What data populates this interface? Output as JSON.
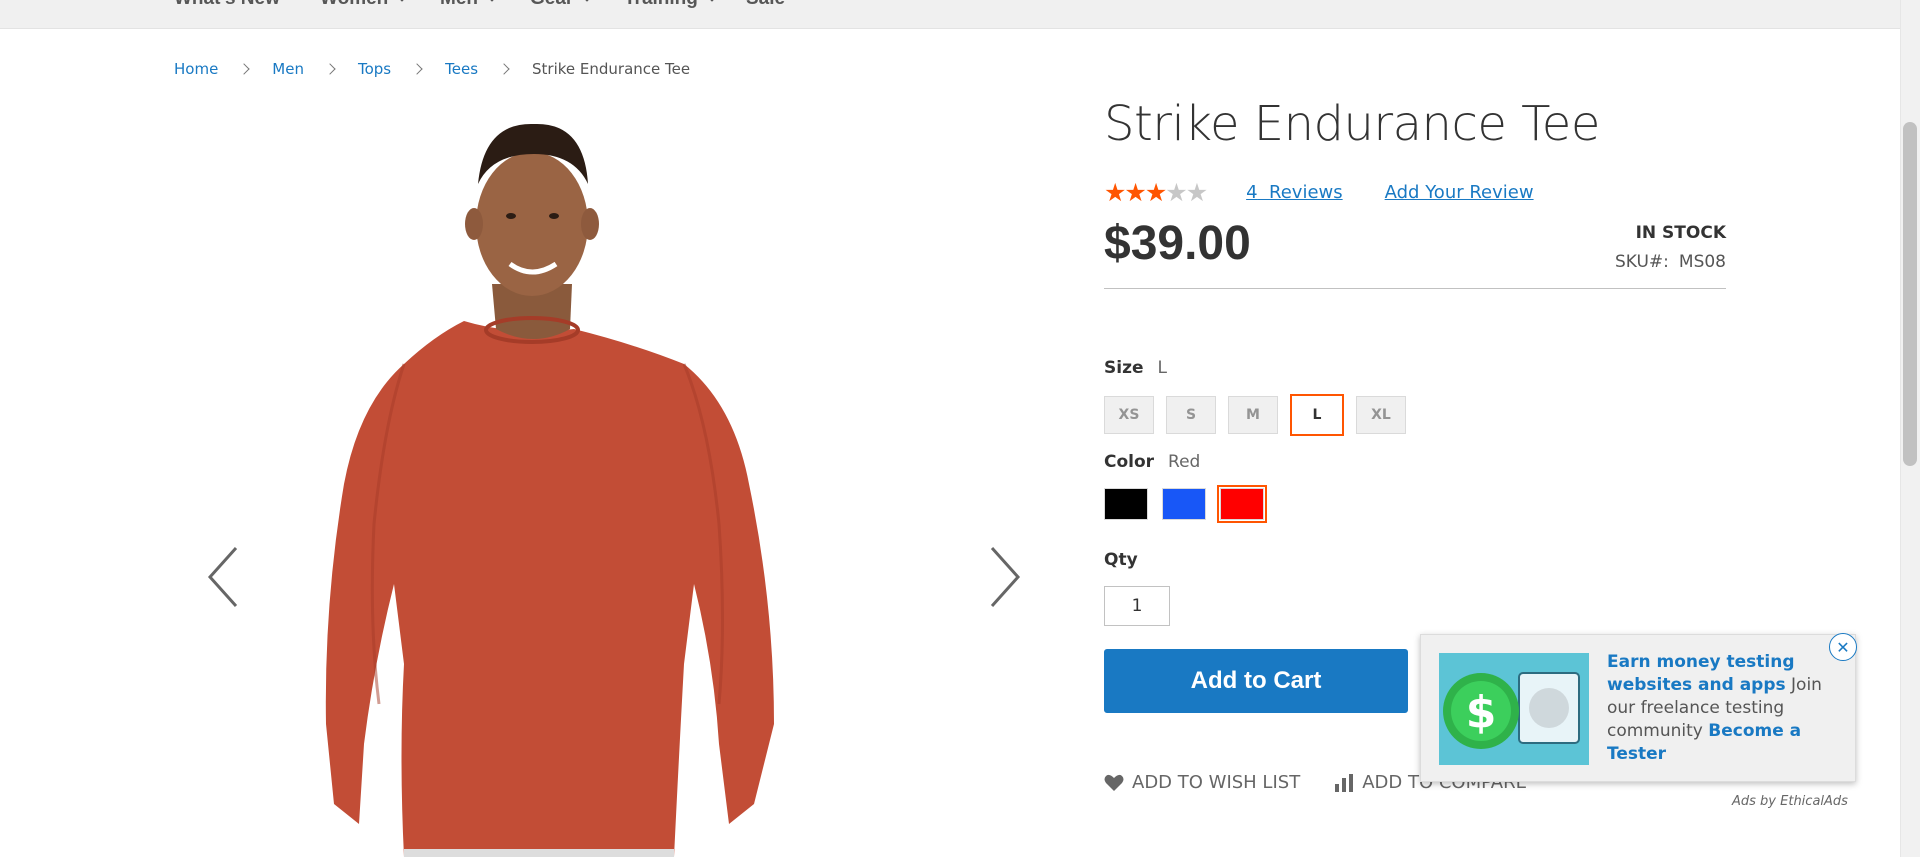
{
  "top_nav": {
    "items": [
      {
        "label": "What's New",
        "has_dropdown": false
      },
      {
        "label": "Women",
        "has_dropdown": true
      },
      {
        "label": "Men",
        "has_dropdown": true
      },
      {
        "label": "Gear",
        "has_dropdown": true
      },
      {
        "label": "Training",
        "has_dropdown": true
      },
      {
        "label": "Sale",
        "has_dropdown": false
      }
    ]
  },
  "breadcrumb": {
    "items": [
      "Home",
      "Men",
      "Tops",
      "Tees"
    ],
    "current": "Strike Endurance Tee"
  },
  "gallery": {
    "image_description": "man-in-red-long-sleeve-tee",
    "prev_icon": "chevron-left-icon",
    "next_icon": "chevron-right-icon"
  },
  "product": {
    "title": "Strike Endurance Tee",
    "rating": {
      "value": 2.5,
      "max": 5
    },
    "reviews_count": "4",
    "reviews_label": "Reviews",
    "add_review_label": "Add Your Review",
    "price": "$39.00",
    "stock_status": "IN STOCK",
    "sku_label": "SKU#:",
    "sku_value": "MS08",
    "size": {
      "label": "Size",
      "selected": "L",
      "options": [
        "XS",
        "S",
        "M",
        "L",
        "XL"
      ]
    },
    "color": {
      "label": "Color",
      "selected": "Red",
      "options": [
        {
          "name": "Black",
          "hex": "#000000"
        },
        {
          "name": "Blue",
          "hex": "#1857f7"
        },
        {
          "name": "Red",
          "hex": "#ff0000"
        }
      ]
    },
    "qty_label": "Qty",
    "qty_value": "1",
    "add_to_cart_label": "Add to Cart",
    "wishlist_label": "ADD TO WISH LIST",
    "compare_label": "ADD TO COMPARE"
  },
  "ad": {
    "headline": "Earn money testing websites and apps",
    "body": " Join our freelance testing community ",
    "cta": "Become a Tester",
    "credit": "Ads by EthicalAds",
    "close_icon": "close-icon"
  },
  "colors": {
    "accent": "#1979c3",
    "selected_border": "#ff5501",
    "star_on": "#ff5501"
  }
}
